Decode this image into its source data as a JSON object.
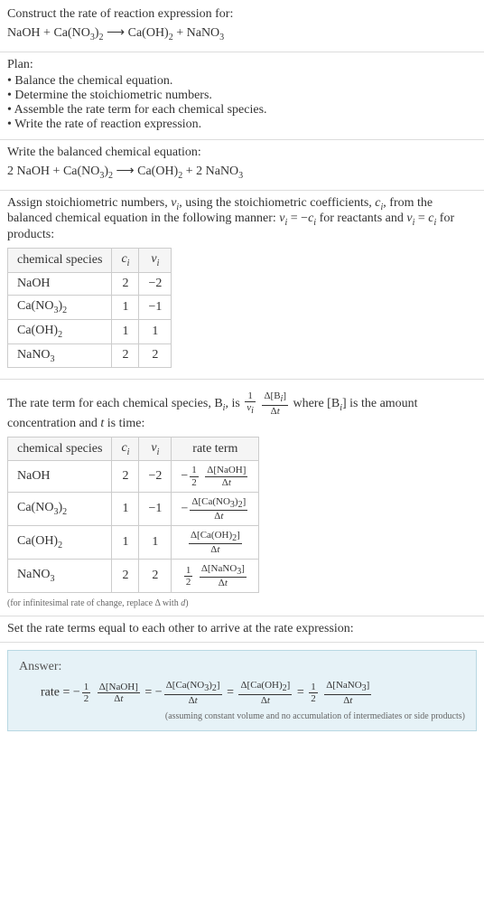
{
  "intro": {
    "line1": "Construct the rate of reaction expression for:",
    "equation_html": "NaOH + Ca(NO<span class='sub'>3</span>)<span class='sub'>2</span> ⟶ Ca(OH)<span class='sub'>2</span> + NaNO<span class='sub'>3</span>"
  },
  "plan": {
    "heading": "Plan:",
    "items": [
      "Balance the chemical equation.",
      "Determine the stoichiometric numbers.",
      "Assemble the rate term for each chemical species.",
      "Write the rate of reaction expression."
    ]
  },
  "balanced": {
    "heading": "Write the balanced chemical equation:",
    "equation_html": "2 NaOH + Ca(NO<span class='sub'>3</span>)<span class='sub'>2</span> ⟶ Ca(OH)<span class='sub'>2</span> + 2 NaNO<span class='sub'>3</span>"
  },
  "assign": {
    "text_html": "Assign stoichiometric numbers, <span class='ital'>ν<span class='sub'>i</span></span>, using the stoichiometric coefficients, <span class='ital'>c<span class='sub'>i</span></span>, from the balanced chemical equation in the following manner: <span class='ital'>ν<span class='sub'>i</span></span> = −<span class='ital'>c<span class='sub'>i</span></span> for reactants and <span class='ital'>ν<span class='sub'>i</span></span> = <span class='ital'>c<span class='sub'>i</span></span> for products:",
    "headers": {
      "species": "chemical species",
      "ci_html": "<span class='ital'>c<span class='sub'>i</span></span>",
      "vi_html": "<span class='ital'>ν<span class='sub'>i</span></span>"
    },
    "rows": [
      {
        "species_html": "NaOH",
        "ci": "2",
        "vi": "−2"
      },
      {
        "species_html": "Ca(NO<span class='sub'>3</span>)<span class='sub'>2</span>",
        "ci": "1",
        "vi": "−1"
      },
      {
        "species_html": "Ca(OH)<span class='sub'>2</span>",
        "ci": "1",
        "vi": "1"
      },
      {
        "species_html": "NaNO<span class='sub'>3</span>",
        "ci": "2",
        "vi": "2"
      }
    ]
  },
  "rate_def": {
    "prefix_html": "The rate term for each chemical species, B<span class='sub ital'>i</span>, is ",
    "frac1_num": "1",
    "frac1_den_html": "<span class='ital'>ν<span class='sub'>i</span></span>",
    "frac2_num_html": "Δ[B<span class='sub ital'>i</span>]",
    "frac2_den_html": "Δ<span class='ital'>t</span>",
    "suffix_html": " where [B<span class='sub ital'>i</span>] is the amount concentration and <span class='ital'>t</span> is time:",
    "headers": {
      "species": "chemical species",
      "ci_html": "<span class='ital'>c<span class='sub'>i</span></span>",
      "vi_html": "<span class='ital'>ν<span class='sub'>i</span></span>",
      "rate": "rate term"
    },
    "rows": [
      {
        "species_html": "NaOH",
        "ci": "2",
        "vi": "−2",
        "rate_html": "−<span class='inline-frac'><span class='num'>1</span><span class='den'>2</span></span> <span class='inline-frac'><span class='num'>Δ[NaOH]</span><span class='den'>Δ<span class='ital'>t</span></span></span>"
      },
      {
        "species_html": "Ca(NO<span class='sub'>3</span>)<span class='sub'>2</span>",
        "ci": "1",
        "vi": "−1",
        "rate_html": "−<span class='inline-frac'><span class='num'>Δ[Ca(NO<span class=\"sub\">3</span>)<span class=\"sub\">2</span>]</span><span class='den'>Δ<span class='ital'>t</span></span></span>"
      },
      {
        "species_html": "Ca(OH)<span class='sub'>2</span>",
        "ci": "1",
        "vi": "1",
        "rate_html": "<span class='inline-frac'><span class='num'>Δ[Ca(OH)<span class=\"sub\">2</span>]</span><span class='den'>Δ<span class='ital'>t</span></span></span>"
      },
      {
        "species_html": "NaNO<span class='sub'>3</span>",
        "ci": "2",
        "vi": "2",
        "rate_html": "<span class='inline-frac'><span class='num'>1</span><span class='den'>2</span></span> <span class='inline-frac'><span class='num'>Δ[NaNO<span class=\"sub\">3</span>]</span><span class='den'>Δ<span class='ital'>t</span></span></span>"
      }
    ],
    "note_html": "(for infinitesimal rate of change, replace Δ with <span class='ital'>d</span>)"
  },
  "set_equal": {
    "text": "Set the rate terms equal to each other to arrive at the rate expression:"
  },
  "answer": {
    "label": "Answer:",
    "eq_html": "rate = −<span class='inline-frac'><span class='num'>1</span><span class='den'>2</span></span> <span class='inline-frac'><span class='num'>Δ[NaOH]</span><span class='den'>Δ<span class='ital'>t</span></span></span> = −<span class='inline-frac'><span class='num'>Δ[Ca(NO<span class=\"sub\">3</span>)<span class=\"sub\">2</span>]</span><span class='den'>Δ<span class='ital'>t</span></span></span> = <span class='inline-frac'><span class='num'>Δ[Ca(OH)<span class=\"sub\">2</span>]</span><span class='den'>Δ<span class='ital'>t</span></span></span> = <span class='inline-frac'><span class='num'>1</span><span class='den'>2</span></span> <span class='inline-frac'><span class='num'>Δ[NaNO<span class=\"sub\">3</span>]</span><span class='den'>Δ<span class='ital'>t</span></span></span>",
    "note": "(assuming constant volume and no accumulation of intermediates or side products)"
  }
}
